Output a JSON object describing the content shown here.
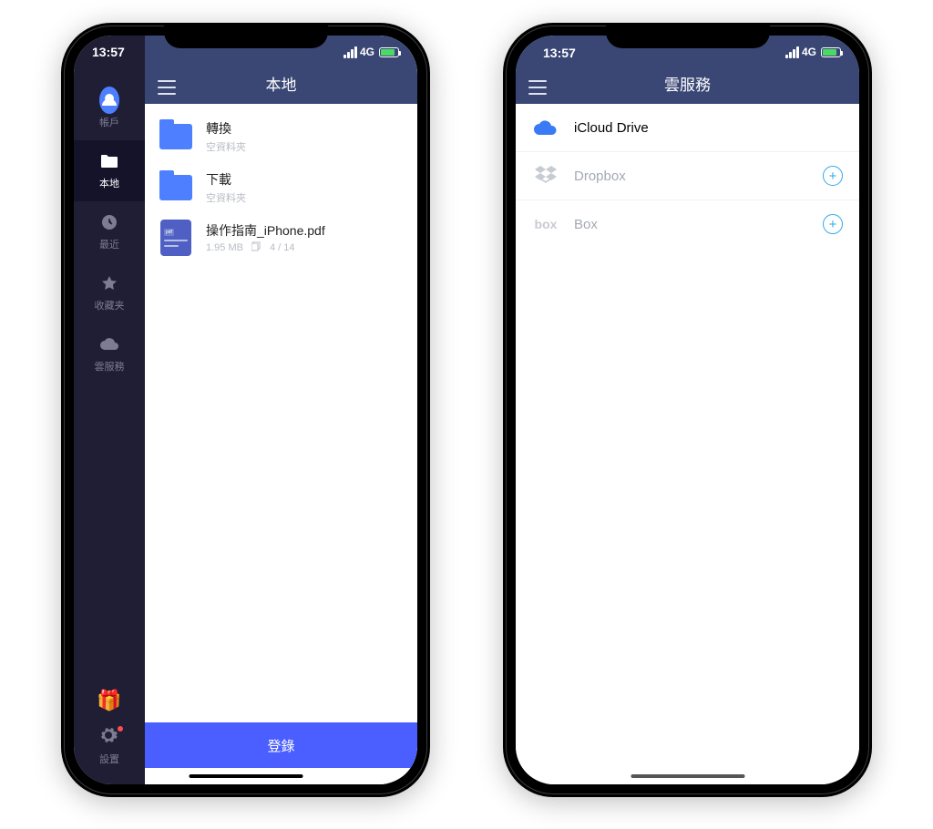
{
  "status": {
    "time": "13:57",
    "network": "4G"
  },
  "phone1": {
    "sidebar": {
      "items": [
        {
          "label": "帳戶",
          "icon": "user"
        },
        {
          "label": "本地",
          "icon": "folder"
        },
        {
          "label": "最近",
          "icon": "clock"
        },
        {
          "label": "收藏夹",
          "icon": "star"
        },
        {
          "label": "雲服務",
          "icon": "cloud"
        }
      ],
      "settings_label": "設置"
    },
    "header": {
      "title": "本地"
    },
    "files": [
      {
        "name": "轉換",
        "meta": "空資料夾",
        "type": "folder"
      },
      {
        "name": "下載",
        "meta": "空資料夾",
        "type": "folder"
      },
      {
        "name": "操作指南_iPhone.pdf",
        "size": "1.95 MB",
        "pages": "4 / 14",
        "type": "pdf"
      }
    ],
    "login_label": "登錄"
  },
  "phone2": {
    "header": {
      "title": "雲服務"
    },
    "services": [
      {
        "name": "iCloud Drive",
        "active": true,
        "addable": false
      },
      {
        "name": "Dropbox",
        "active": false,
        "addable": true
      },
      {
        "name": "Box",
        "active": false,
        "addable": true
      }
    ]
  }
}
